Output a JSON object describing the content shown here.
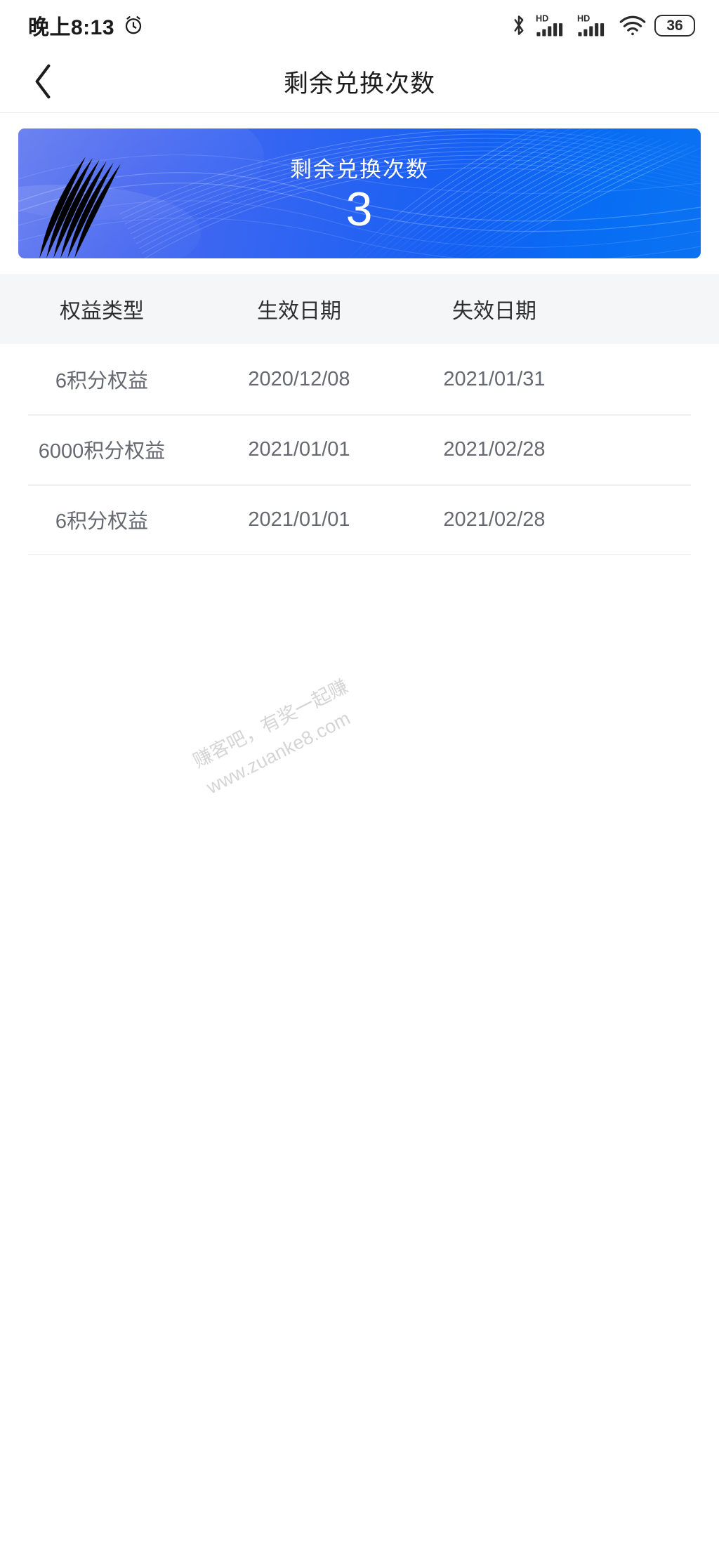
{
  "status_bar": {
    "time": "晚上8:13",
    "alarm_icon": "alarm-clock-icon",
    "bluetooth_icon": "bluetooth-icon",
    "signal_1_label": "HD",
    "signal_2_label": "HD",
    "wifi_icon": "wifi-icon",
    "battery_level": "36"
  },
  "nav": {
    "back_icon": "chevron-left-icon",
    "title": "剩余兑换次数"
  },
  "banner": {
    "label": "剩余兑换次数",
    "count": "3",
    "gradient_start": "#5b74ee",
    "gradient_end": "#0b73f2",
    "text_color": "#ffffff"
  },
  "table": {
    "headers": [
      "权益类型",
      "生效日期",
      "失效日期"
    ],
    "header_bg": "#f5f6f8",
    "rows": [
      {
        "type": "6积分权益",
        "start": "2020/12/08",
        "end": "2021/01/31"
      },
      {
        "type": "6000积分权益",
        "start": "2021/01/01",
        "end": "2021/02/28"
      },
      {
        "type": "6积分权益",
        "start": "2021/01/01",
        "end": "2021/02/28"
      }
    ]
  },
  "watermark": {
    "line1": "赚客吧，有奖一起赚",
    "line2": "www.zuanke8.com"
  }
}
